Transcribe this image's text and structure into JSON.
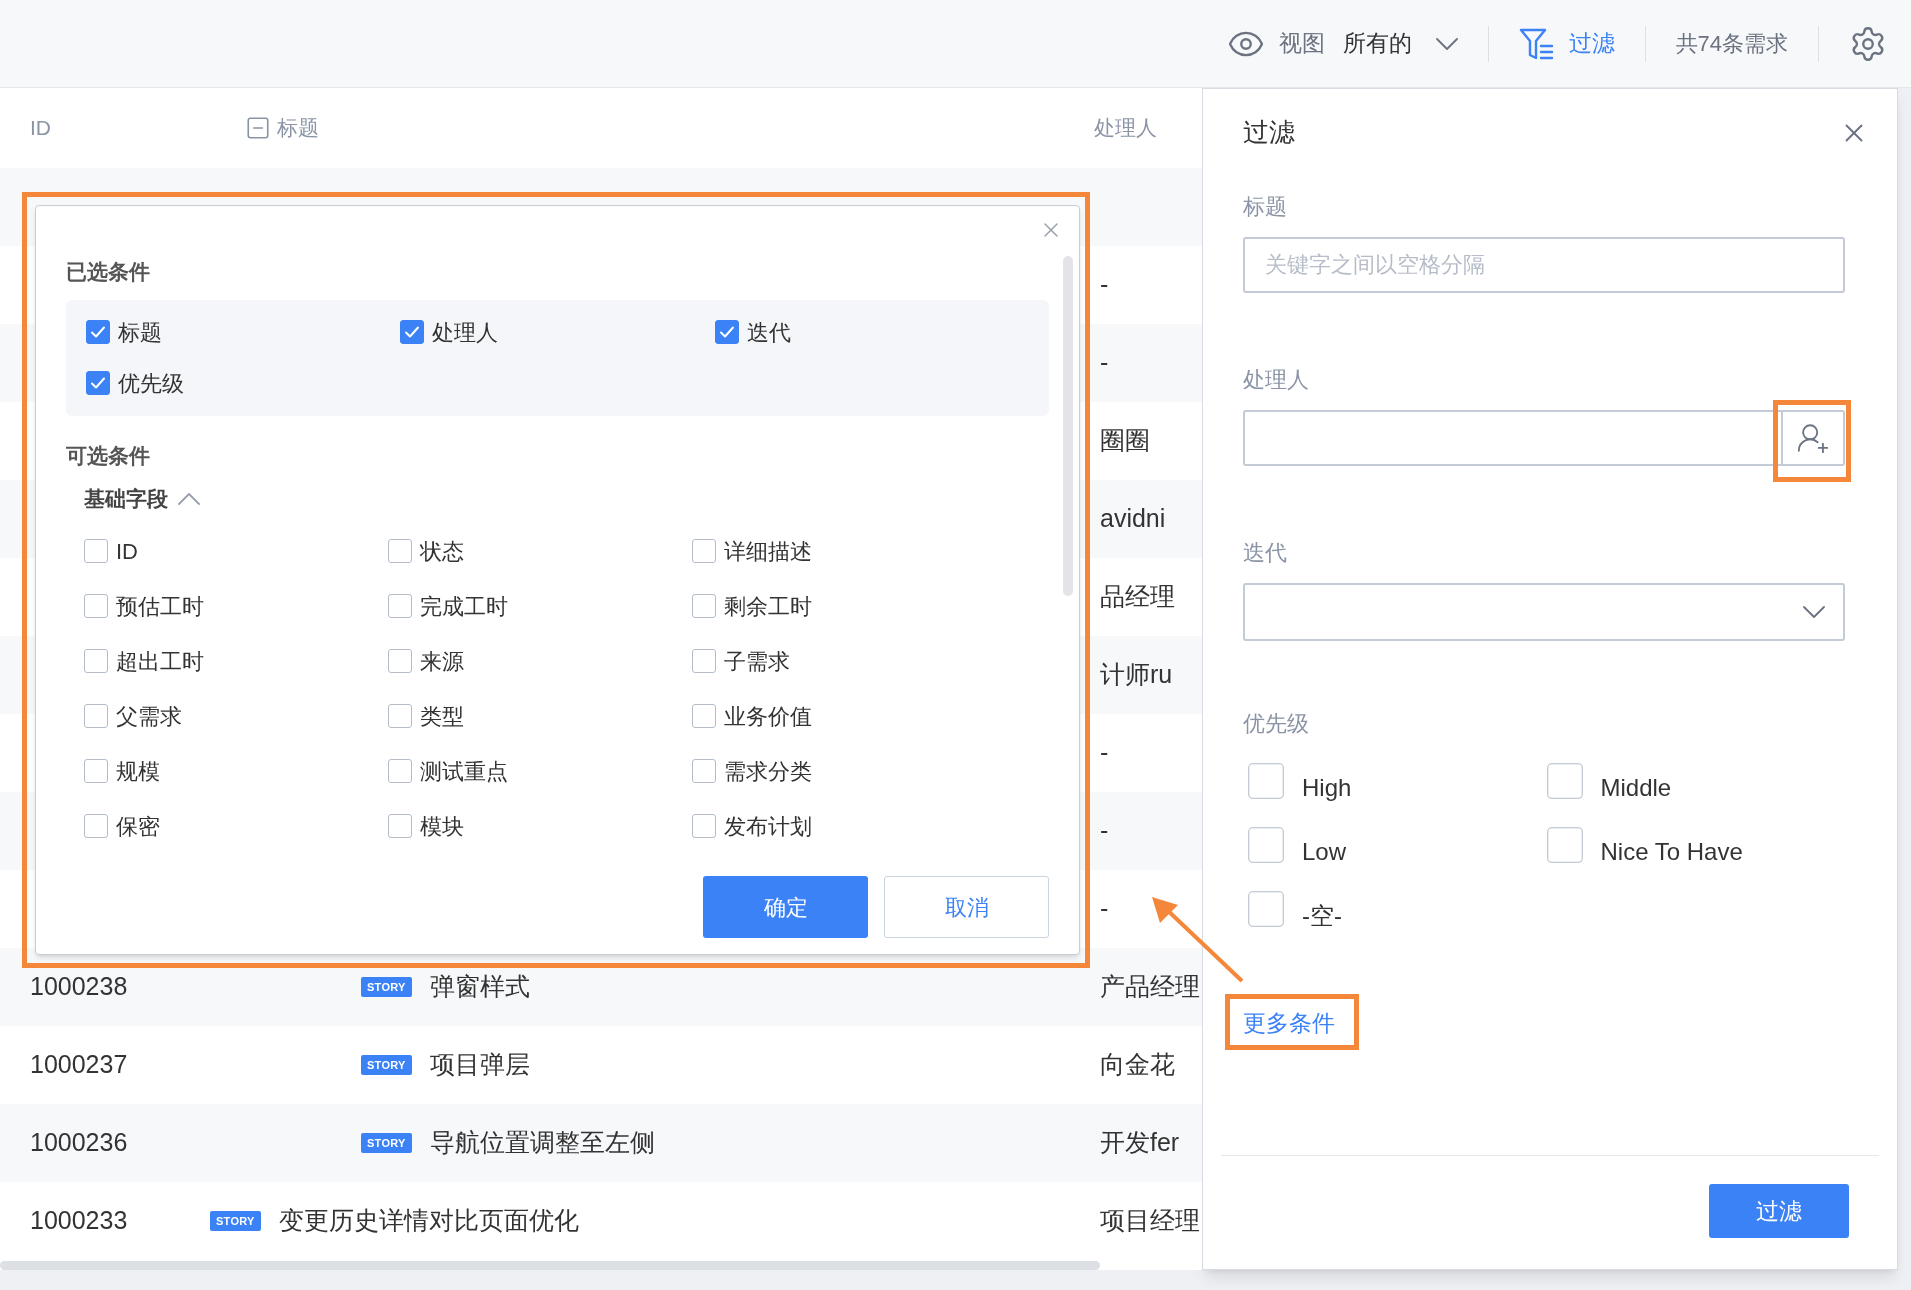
{
  "toolbar": {
    "view_label": "视图",
    "view_value": "所有的",
    "filter_label": "过滤",
    "count": "共74条需求"
  },
  "table": {
    "columns": [
      "ID",
      "标题",
      "处理人"
    ],
    "rows": [
      {
        "owner": "-"
      },
      {
        "owner": "-"
      },
      {
        "owner": "圈圈"
      },
      {
        "owner": "avidni"
      },
      {
        "owner": "品经理"
      },
      {
        "owner": "计师ru"
      },
      {
        "owner": "-"
      },
      {
        "owner": "-"
      },
      {
        "owner": "-"
      },
      {
        "id": "1000238",
        "badge": "STORY",
        "title": "弹窗样式",
        "owner": "产品经理"
      },
      {
        "id": "1000237",
        "badge": "STORY",
        "title": "项目弹层",
        "owner": "向金花"
      },
      {
        "id": "1000236",
        "badge": "STORY",
        "title": "导航位置调整至左侧",
        "owner": "开发fer"
      },
      {
        "id": "1000233",
        "badge": "STORY",
        "title": "变更历史详情对比页面优化",
        "owner": "项目经理"
      }
    ]
  },
  "dialog": {
    "selected_title": "已选条件",
    "selected": [
      {
        "label": "标题",
        "checked": true
      },
      {
        "label": "处理人",
        "checked": true
      },
      {
        "label": "迭代",
        "checked": true
      },
      {
        "label": "优先级",
        "checked": true
      }
    ],
    "optional_title": "可选条件",
    "group": {
      "label": "基础字段",
      "expanded": true
    },
    "options": [
      {
        "label": "ID",
        "checked": false
      },
      {
        "label": "状态",
        "checked": false
      },
      {
        "label": "详细描述",
        "checked": false
      },
      {
        "label": "预估工时",
        "checked": false
      },
      {
        "label": "完成工时",
        "checked": false
      },
      {
        "label": "剩余工时",
        "checked": false
      },
      {
        "label": "超出工时",
        "checked": false
      },
      {
        "label": "来源",
        "checked": false
      },
      {
        "label": "子需求",
        "checked": false
      },
      {
        "label": "父需求",
        "checked": false
      },
      {
        "label": "类型",
        "checked": false
      },
      {
        "label": "业务价值",
        "checked": false
      },
      {
        "label": "规模",
        "checked": false
      },
      {
        "label": "测试重点",
        "checked": false
      },
      {
        "label": "需求分类",
        "checked": false
      },
      {
        "label": "保密",
        "checked": false
      },
      {
        "label": "模块",
        "checked": false
      },
      {
        "label": "发布计划",
        "checked": false
      }
    ],
    "ok": "确定",
    "cancel": "取消"
  },
  "panel": {
    "title": "过滤",
    "fields": [
      {
        "kind": "text",
        "label": "标题",
        "placeholder": "关键字之间以空格分隔"
      },
      {
        "kind": "user",
        "label": "处理人"
      },
      {
        "kind": "select",
        "label": "迭代"
      }
    ],
    "priority": {
      "label": "优先级",
      "options": [
        {
          "label": "High",
          "checked": false
        },
        {
          "label": "Middle",
          "checked": false
        },
        {
          "label": "Low",
          "checked": false
        },
        {
          "label": "Nice To Have",
          "checked": false
        },
        {
          "label": "-空-",
          "checked": false
        }
      ]
    },
    "more_link": "更多条件",
    "submit": "过滤"
  }
}
